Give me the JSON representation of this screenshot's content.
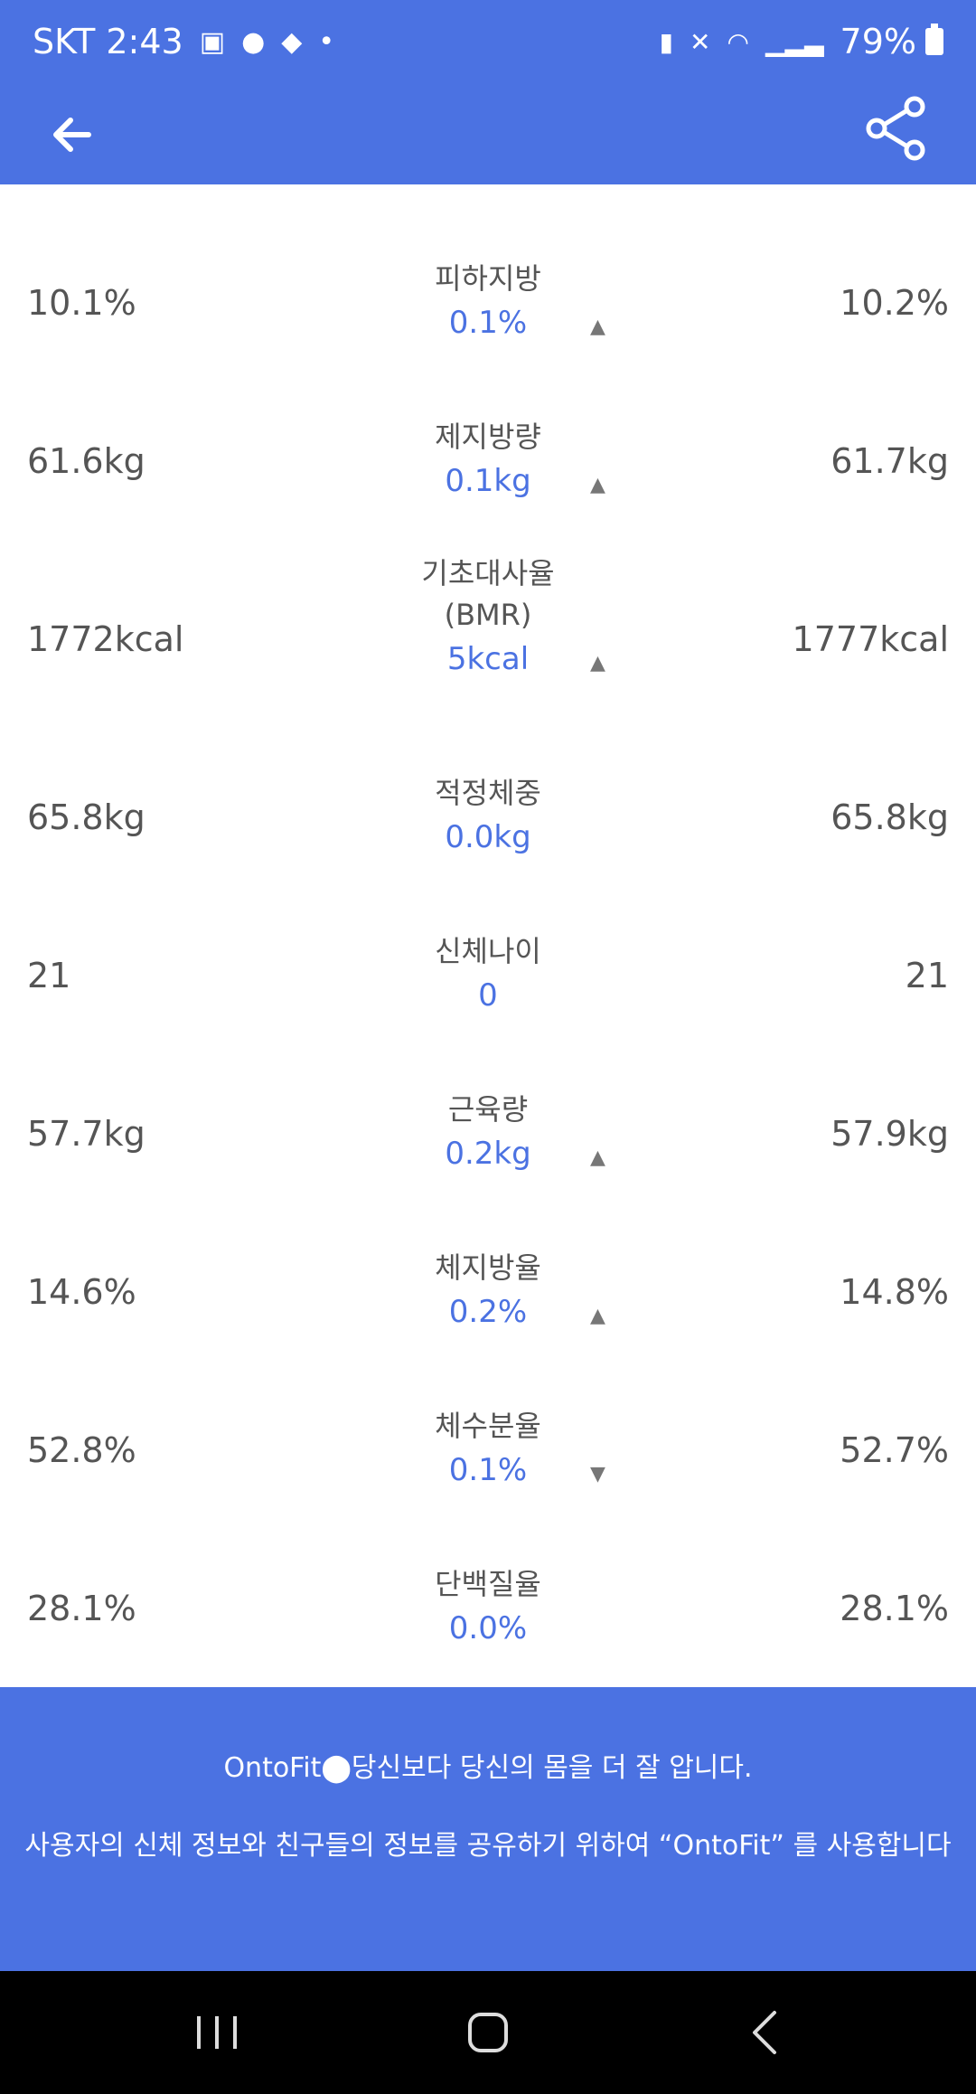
{
  "status_bar": {
    "carrier_time": "SKT 2:43",
    "battery": "79%",
    "icons": [
      "gallery-icon",
      "talk-icon",
      "chat-icon",
      "dot-icon",
      "battery-saver-icon",
      "mute-icon",
      "wifi-icon",
      "signal-icon",
      "battery-icon"
    ]
  },
  "app_bar": {
    "back_icon": "arrow-left-icon",
    "share_icon": "share-icon"
  },
  "rows": [
    {
      "label": "피하지방",
      "left": "10.1%",
      "right": "10.2%",
      "diff": "0.1%",
      "arrow": "up"
    },
    {
      "label": "제지방량",
      "left": "61.6kg",
      "right": "61.7kg",
      "diff": "0.1kg",
      "arrow": "up"
    },
    {
      "label": "기초대사율\n(BMR)",
      "left": "1772kcal",
      "right": "1777kcal",
      "diff": "5kcal",
      "arrow": "up"
    },
    {
      "label": "적정체중",
      "left": "65.8kg",
      "right": "65.8kg",
      "diff": "0.0kg",
      "arrow": ""
    },
    {
      "label": "신체나이",
      "left": "21",
      "right": "21",
      "diff": "0",
      "arrow": ""
    },
    {
      "label": "근육량",
      "left": "57.7kg",
      "right": "57.9kg",
      "diff": "0.2kg",
      "arrow": "up"
    },
    {
      "label": "체지방율",
      "left": "14.6%",
      "right": "14.8%",
      "diff": "0.2%",
      "arrow": "up"
    },
    {
      "label": "체수분율",
      "left": "52.8%",
      "right": "52.7%",
      "diff": "0.1%",
      "arrow": "down"
    },
    {
      "label": "단백질율",
      "left": "28.1%",
      "right": "28.1%",
      "diff": "0.0%",
      "arrow": ""
    }
  ],
  "footer": {
    "line1": "OntoFit⬤당신보다 당신의 몸을 더 잘 압니다.",
    "line2": "사용자의 신체 정보와 친구들의 정보를 공유하기 위하여 “OntoFit” 를 사용합니다"
  },
  "nav_bar": {
    "icons": [
      "recent-apps-icon",
      "home-icon",
      "back-icon"
    ]
  }
}
